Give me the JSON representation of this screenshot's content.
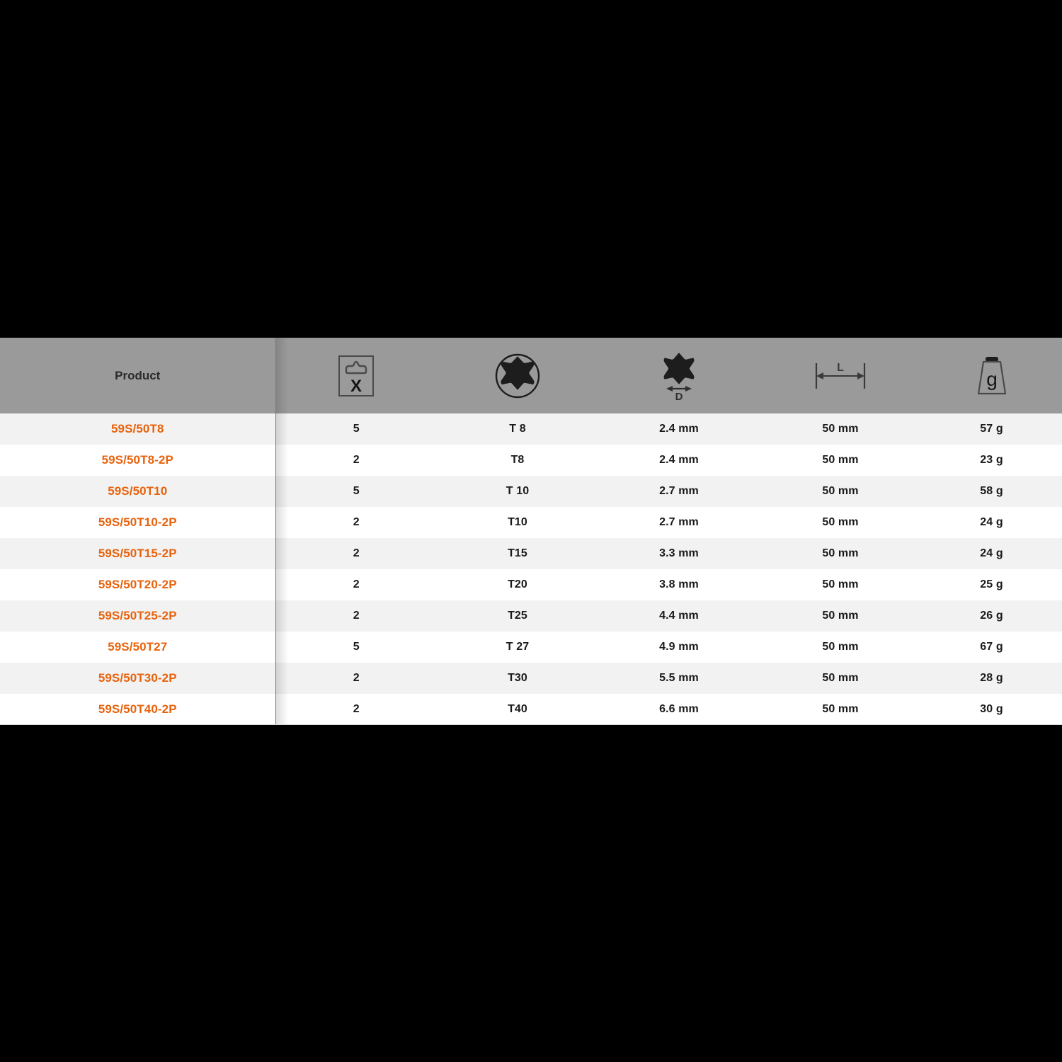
{
  "table": {
    "columns": [
      {
        "key": "product",
        "label": "Product",
        "icon": "none"
      },
      {
        "key": "qty",
        "label": "",
        "icon": "blister-pack-x-icon"
      },
      {
        "key": "size",
        "label": "",
        "icon": "torx-star-in-circle-icon"
      },
      {
        "key": "dia",
        "label": "",
        "icon": "torx-star-diameter-d-icon"
      },
      {
        "key": "len",
        "label": "",
        "icon": "length-dimension-l-icon"
      },
      {
        "key": "wt",
        "label": "",
        "icon": "weight-gram-icon"
      }
    ],
    "icon_letters": {
      "blister_pack": "X",
      "diameter": "D",
      "length": "L",
      "weight": "g"
    },
    "rows": [
      {
        "product": "59S/50T8",
        "qty": "5",
        "size": "T 8",
        "dia": "2.4 mm",
        "len": "50 mm",
        "wt": "57 g"
      },
      {
        "product": "59S/50T8-2P",
        "qty": "2",
        "size": "T8",
        "dia": "2.4 mm",
        "len": "50 mm",
        "wt": "23 g"
      },
      {
        "product": "59S/50T10",
        "qty": "5",
        "size": "T 10",
        "dia": "2.7 mm",
        "len": "50 mm",
        "wt": "58 g"
      },
      {
        "product": "59S/50T10-2P",
        "qty": "2",
        "size": "T10",
        "dia": "2.7 mm",
        "len": "50 mm",
        "wt": "24 g"
      },
      {
        "product": "59S/50T15-2P",
        "qty": "2",
        "size": "T15",
        "dia": "3.3 mm",
        "len": "50 mm",
        "wt": "24 g"
      },
      {
        "product": "59S/50T20-2P",
        "qty": "2",
        "size": "T20",
        "dia": "3.8 mm",
        "len": "50 mm",
        "wt": "25 g"
      },
      {
        "product": "59S/50T25-2P",
        "qty": "2",
        "size": "T25",
        "dia": "4.4 mm",
        "len": "50 mm",
        "wt": "26 g"
      },
      {
        "product": "59S/50T27",
        "qty": "5",
        "size": "T 27",
        "dia": "4.9 mm",
        "len": "50 mm",
        "wt": "67 g"
      },
      {
        "product": "59S/50T30-2P",
        "qty": "2",
        "size": "T30",
        "dia": "5.5 mm",
        "len": "50 mm",
        "wt": "28 g"
      },
      {
        "product": "59S/50T40-2P",
        "qty": "2",
        "size": "T40",
        "dia": "6.6 mm",
        "len": "50 mm",
        "wt": "30 g"
      }
    ]
  },
  "colors": {
    "page_background": "#000000",
    "header_background": "#9a9a9a",
    "row_odd": "#f2f2f2",
    "row_even": "#ffffff",
    "product_link": "#e8620c",
    "body_text": "#1a1a1a",
    "icon_stroke": "#3a3a3a"
  }
}
